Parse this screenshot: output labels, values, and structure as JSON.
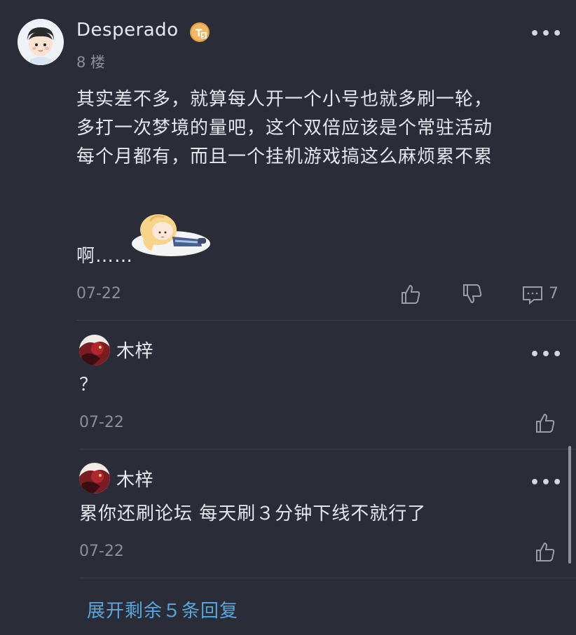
{
  "post": {
    "username": "Desperado",
    "badge_icon": "level-badge-icon",
    "floor": "8 楼",
    "content_lines": [
      "其实差不多，就算每人开一个小号也就多刷一轮，",
      "多打一次梦境的量吧，这个双倍应该是个常驻活动",
      "每个月都有，而且一个挂机游戏搞这么麻烦累不累"
    ],
    "content_tail": "啊……",
    "sticker_icon": "anime-girl-lying-sticker",
    "date": "07-22",
    "comment_count": "7",
    "more_label": "•••"
  },
  "replies": [
    {
      "username": "木梓",
      "content": "？",
      "date": "07-22",
      "more_label": "•••"
    },
    {
      "username": "木梓",
      "content": "累你还刷论坛 每天刷３分钟下线不就行了",
      "date": "07-22",
      "more_label": "•••"
    }
  ],
  "expand_label": "展开剩余５条回复",
  "colors": {
    "background": "#2a2c38",
    "text": "#e6e7ec",
    "muted": "#8c8e99",
    "link": "#58a6dc"
  }
}
